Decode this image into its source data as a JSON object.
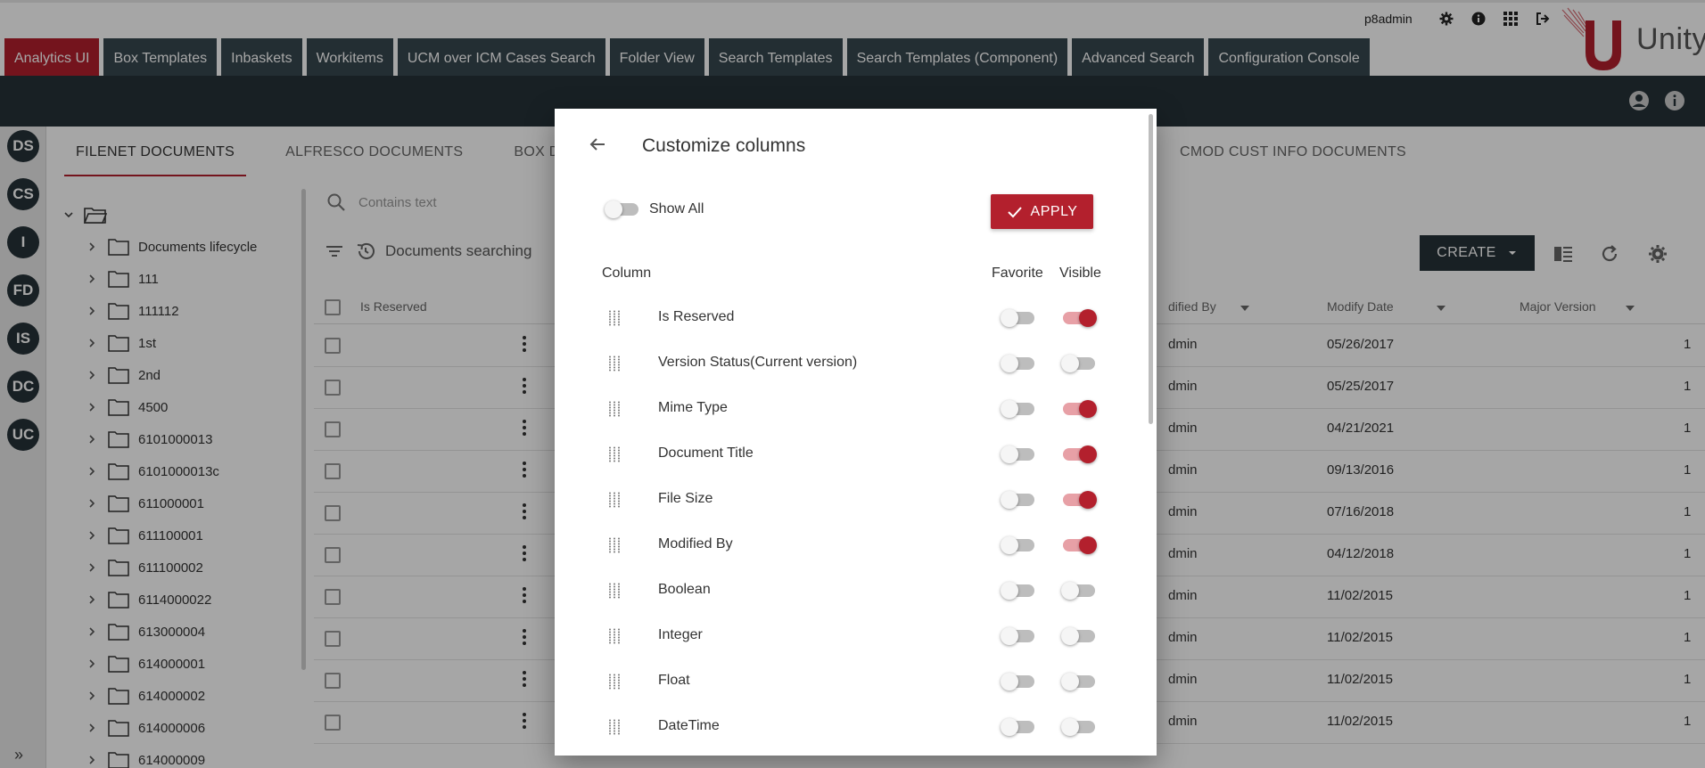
{
  "header": {
    "tabs": [
      {
        "label": "Analytics UI",
        "active": true
      },
      {
        "label": "Box Templates"
      },
      {
        "label": "Inbaskets"
      },
      {
        "label": "Workitems"
      },
      {
        "label": "UCM over ICM Cases Search"
      },
      {
        "label": "Folder View"
      },
      {
        "label": "Search Templates"
      },
      {
        "label": "Search Templates (Component)"
      },
      {
        "label": "Advanced Search"
      },
      {
        "label": "Configuration Console"
      }
    ],
    "username": "p8admin",
    "brand": "Unity",
    "icons": [
      "gear-icon",
      "info-icon",
      "apps-grid-icon",
      "logout-icon"
    ]
  },
  "rail": {
    "items": [
      "DS",
      "CS",
      "I",
      "FD",
      "IS",
      "DC",
      "UC"
    ],
    "expand": "»"
  },
  "repo_tabs": [
    "FILENET DOCUMENTS",
    "ALFRESCO DOCUMENTS",
    "BOX DOCUM",
    "CMOD CUST INFO DOCUMENTS"
  ],
  "tree": {
    "items": [
      "Documents lifecycle",
      "111",
      "111112",
      "1st",
      "2nd",
      "4500",
      "6101000013",
      "6101000013c",
      "611000001",
      "611100001",
      "611100002",
      "6114000022",
      "613000004",
      "614000001",
      "614000002",
      "614000006",
      "614000009"
    ]
  },
  "grid": {
    "search_placeholder": "Contains text",
    "doc_search_label": "Documents searching",
    "create_label": "CREATE",
    "columns": {
      "is_reserved": "Is Reserved",
      "modified_by": "dified By",
      "modify_date": "Modify Date",
      "major_version": "Major Version"
    },
    "rows": [
      {
        "modified_by": "dmin",
        "date": "05/26/2017",
        "version": "1"
      },
      {
        "modified_by": "dmin",
        "date": "05/25/2017",
        "version": "1"
      },
      {
        "modified_by": "dmin",
        "date": "04/21/2021",
        "version": "1"
      },
      {
        "modified_by": "dmin",
        "date": "09/13/2016",
        "version": "1"
      },
      {
        "modified_by": "dmin",
        "date": "07/16/2018",
        "version": "1"
      },
      {
        "modified_by": "dmin",
        "date": "04/12/2018",
        "version": "1"
      },
      {
        "modified_by": "dmin",
        "date": "11/02/2015",
        "version": "1"
      },
      {
        "modified_by": "dmin",
        "date": "11/02/2015",
        "version": "1"
      },
      {
        "modified_by": "dmin",
        "date": "11/02/2015",
        "version": "1"
      },
      {
        "modified_by": "dmin",
        "date": "11/02/2015",
        "version": "1"
      }
    ]
  },
  "dialog": {
    "title": "Customize columns",
    "show_all_label": "Show All",
    "show_all_on": false,
    "apply_label": "APPLY",
    "column_header": "Column",
    "favorite_header": "Favorite",
    "visible_header": "Visible",
    "columns": [
      {
        "name": "Is Reserved",
        "favorite": false,
        "visible": true
      },
      {
        "name": "Version Status(Current version)",
        "favorite": false,
        "visible": false
      },
      {
        "name": "Mime Type",
        "favorite": false,
        "visible": true
      },
      {
        "name": "Document Title",
        "favorite": false,
        "visible": true
      },
      {
        "name": "File Size",
        "favorite": false,
        "visible": true
      },
      {
        "name": "Modified By",
        "favorite": false,
        "visible": true
      },
      {
        "name": "Boolean",
        "favorite": false,
        "visible": false
      },
      {
        "name": "Integer",
        "favorite": false,
        "visible": false
      },
      {
        "name": "Float",
        "favorite": false,
        "visible": false
      },
      {
        "name": "DateTime",
        "favorite": false,
        "visible": false
      }
    ]
  },
  "colors": {
    "accent": "#b3202d",
    "dark": "#263238",
    "tab": "#37474f"
  }
}
